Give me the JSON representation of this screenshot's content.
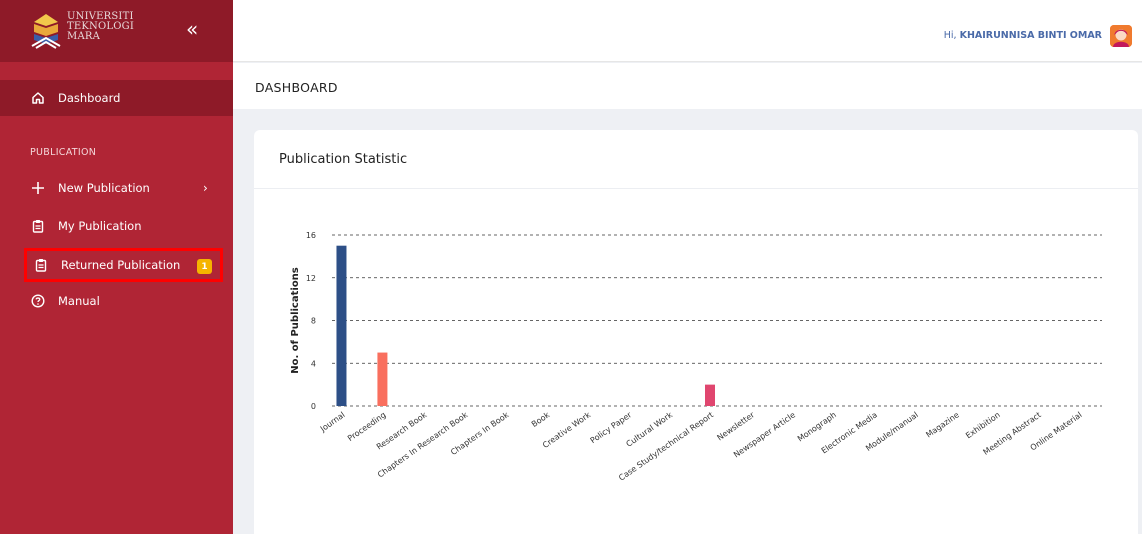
{
  "brand": {
    "line1": "UNIVERSITI",
    "line2": "TEKNOLOGI",
    "line3": "MARA",
    "collapse_icon": "double-chevron-left-icon"
  },
  "sidebar": {
    "dashboard_label": "Dashboard",
    "section_label": "PUBLICATION",
    "items": [
      {
        "label": "New Publication",
        "icon": "plus-icon"
      },
      {
        "label": "My Publication",
        "icon": "clipboard-icon"
      },
      {
        "label": "Returned Publication",
        "icon": "clipboard-icon",
        "badge": "1"
      },
      {
        "label": "Manual",
        "icon": "question-circle-icon"
      }
    ]
  },
  "topbar": {
    "greeting_prefix": "Hi, ",
    "user_name": "KHAIRUNNISA BINTI OMAR"
  },
  "page": {
    "title": "DASHBOARD",
    "card_title": "Publication Statistic"
  },
  "colors": {
    "sidebar": "#b02535",
    "sidebar_dark": "#8e1a28",
    "badge": "#f5b400",
    "highlight": "#ff0000"
  },
  "chart_data": {
    "type": "bar",
    "title": "",
    "xlabel": "",
    "ylabel": "No. of Publications",
    "ylim": [
      0,
      16
    ],
    "yticks": [
      0,
      4,
      8,
      12,
      16
    ],
    "grid": true,
    "categories": [
      "Journal",
      "Proceeding",
      "Research Book",
      "Chapters In Research Book",
      "Chapters In Book",
      "Book",
      "Creative Work",
      "Policy Paper",
      "Cultural Work",
      "Case Study/technical Report",
      "Newsletter",
      "Newspaper Article",
      "Monograph",
      "Electronic Media",
      "Module/manual",
      "Magazine",
      "Exhibition",
      "Meeting Abstract",
      "Online Material"
    ],
    "values": [
      15,
      5,
      0,
      0,
      0,
      0,
      0,
      0,
      0,
      2,
      0,
      0,
      0,
      0,
      0,
      0,
      0,
      0,
      0
    ],
    "bar_colors": {
      "0": "#2d4f87",
      "1": "#f96f5e",
      "9": "#e0466f"
    }
  }
}
